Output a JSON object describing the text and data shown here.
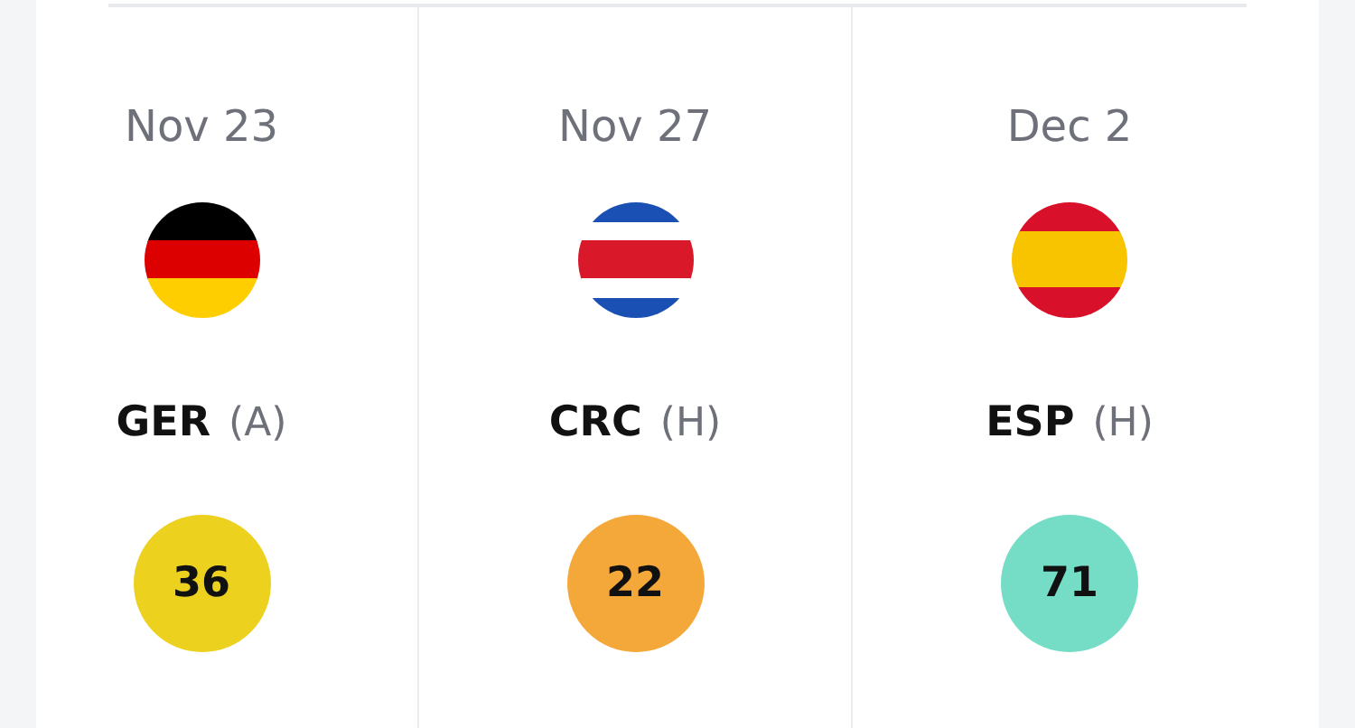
{
  "fixtures": [
    {
      "date": "Nov 23",
      "kind": "germany",
      "team": "GER",
      "venue": "(A)",
      "score": "36",
      "color": "#ecd11f"
    },
    {
      "date": "Nov 27",
      "kind": "costarica",
      "team": "CRC",
      "venue": "(H)",
      "score": "22",
      "color": "#f5a83a"
    },
    {
      "date": "Dec 2",
      "kind": "spain",
      "team": "ESP",
      "venue": "(H)",
      "score": "71",
      "color": "#75dcc6"
    }
  ]
}
